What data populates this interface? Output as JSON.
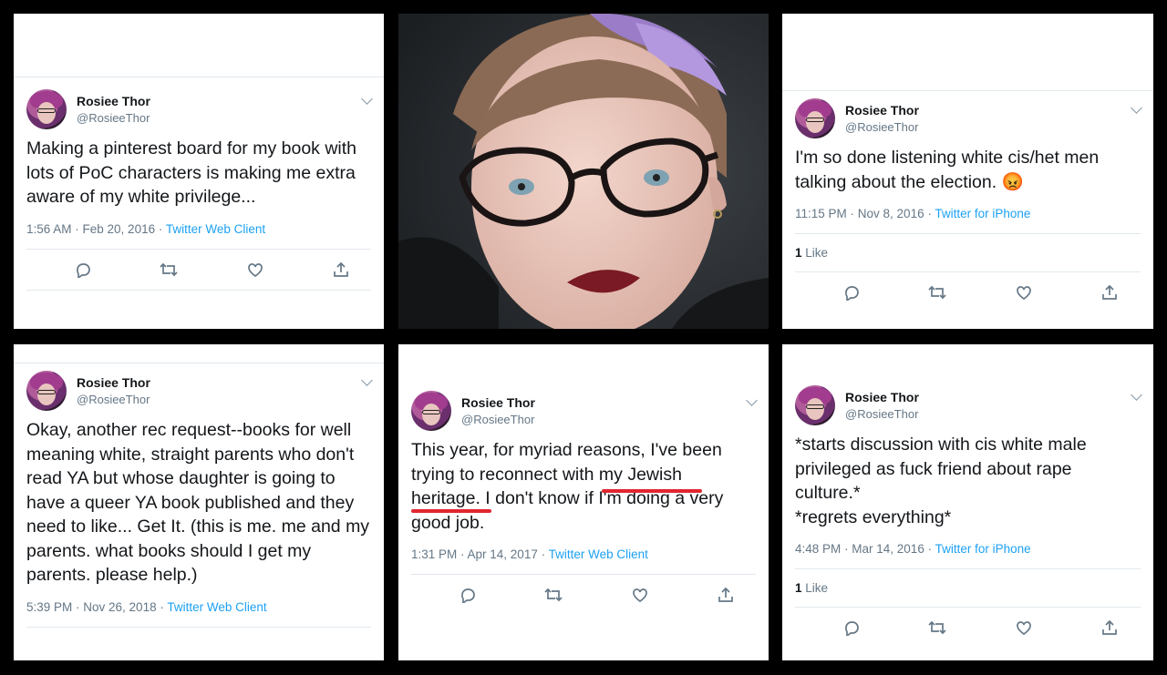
{
  "tweets": [
    {
      "name": "Rosiee Thor",
      "handle": "@RosieeThor",
      "text": "Making a pinterest board for my book with lots of PoC characters is making me extra aware of my white privilege...",
      "time": "1:56 AM · Feb 20, 2016 · ",
      "client": "Twitter Web Client",
      "likes": ""
    },
    {
      "name": "Rosiee Thor",
      "handle": "@RosieeThor",
      "text": "I'm so done listening white cis/het men talking about the election. 😡",
      "time": "11:15 PM · Nov 8, 2016 · ",
      "client": "Twitter for iPhone",
      "likes_count": "1",
      "likes_label": " Like"
    },
    {
      "name": "Rosiee Thor",
      "handle": "@RosieeThor",
      "text": "Okay, another rec request--books for well meaning white, straight parents who don't read YA but whose daughter is going to have a queer YA book published and they need to like... Get It. (this is me. me and my parents. what books should I get my parents. please help.)",
      "time": "5:39 PM · Nov 26, 2018 · ",
      "client": "Twitter Web Client"
    },
    {
      "name": "Rosiee Thor",
      "handle": "@RosieeThor",
      "text": "This year, for myriad reasons, I've been trying to reconnect with my Jewish heritage. I don't know if I'm doing a very good job.",
      "time": "1:31 PM · Apr 14, 2017 · ",
      "client": "Twitter Web Client"
    },
    {
      "name": "Rosiee Thor",
      "handle": "@RosieeThor",
      "text": "*starts discussion with cis white male privileged as fuck friend about rape culture.*\n*regrets everything*",
      "time": "4:48 PM · Mar 14, 2016 · ",
      "client": "Twitter for iPhone",
      "likes_count": "1",
      "likes_label": " Like"
    }
  ],
  "icons": [
    "reply-icon",
    "retweet-icon",
    "like-icon",
    "share-icon",
    "chevron-down-icon"
  ],
  "colors": {
    "link": "#1da1f2",
    "muted": "#657786",
    "highlight": "#e0262f"
  }
}
